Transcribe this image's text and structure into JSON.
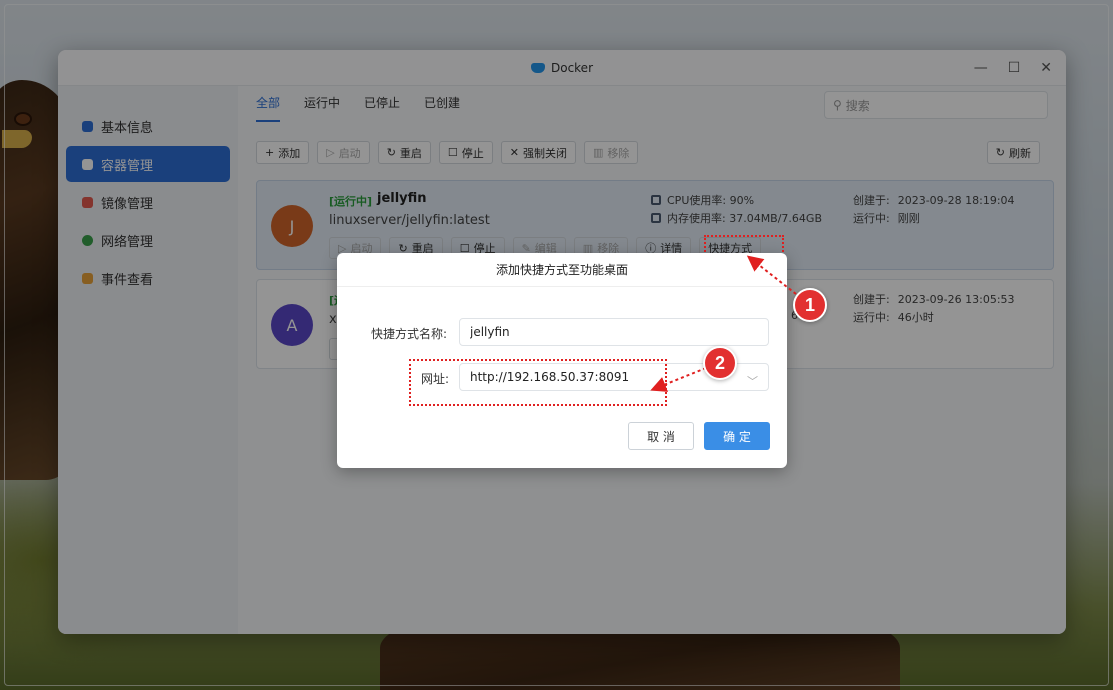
{
  "window": {
    "title": "Docker"
  },
  "win_controls": {
    "minimize": "—",
    "maximize": "☐",
    "close": "✕"
  },
  "sidebar": {
    "items": [
      {
        "label": "基本信息",
        "color": "#2d6fd6"
      },
      {
        "label": "容器管理",
        "color": "#ffffff"
      },
      {
        "label": "镜像管理",
        "color": "#e35b4f"
      },
      {
        "label": "网络管理",
        "color": "#3aa04a"
      },
      {
        "label": "事件查看",
        "color": "#e8a33a"
      }
    ]
  },
  "tabs": [
    "全部",
    "运行中",
    "已停止",
    "已创建"
  ],
  "search": {
    "placeholder": "搜索",
    "icon": "search-icon"
  },
  "toolbar": {
    "add": "添加",
    "start": "启动",
    "restart": "重启",
    "stop": "停止",
    "force_close": "强制关闭",
    "remove": "移除",
    "refresh": "刷新"
  },
  "containers": [
    {
      "avatar": "J",
      "avatar_color": "#d0652a",
      "status": "[运行中]",
      "name": "jellyfin",
      "image": "linuxserver/jellyfin:latest",
      "cpu": "CPU使用率: 90%",
      "mem": "内存使用率: 37.04MB/7.64GB",
      "created_label": "创建于:",
      "created": "2023-09-28 18:19:04",
      "running_label": "运行中:",
      "running": "刚刚",
      "actions": [
        "启动",
        "重启",
        "停止",
        "编辑",
        "移除",
        "详情",
        "快捷方式"
      ]
    },
    {
      "avatar": "A",
      "avatar_color": "#5a48c8",
      "status": "[运",
      "image": "xh",
      "mem_fragment": "6",
      "created_label": "创建于:",
      "created": "2023-09-26 13:05:53",
      "running_label": "运行中:",
      "running": "46小时"
    }
  ],
  "dialog": {
    "title": "添加快捷方式至功能桌面",
    "name_label": "快捷方式名称:",
    "name_value": "jellyfin",
    "url_label": "网址:",
    "url_value": "http://192.168.50.37:8091",
    "cancel": "取 消",
    "ok": "确 定"
  },
  "callouts": {
    "one": "1",
    "two": "2",
    "color": "#e02020"
  }
}
